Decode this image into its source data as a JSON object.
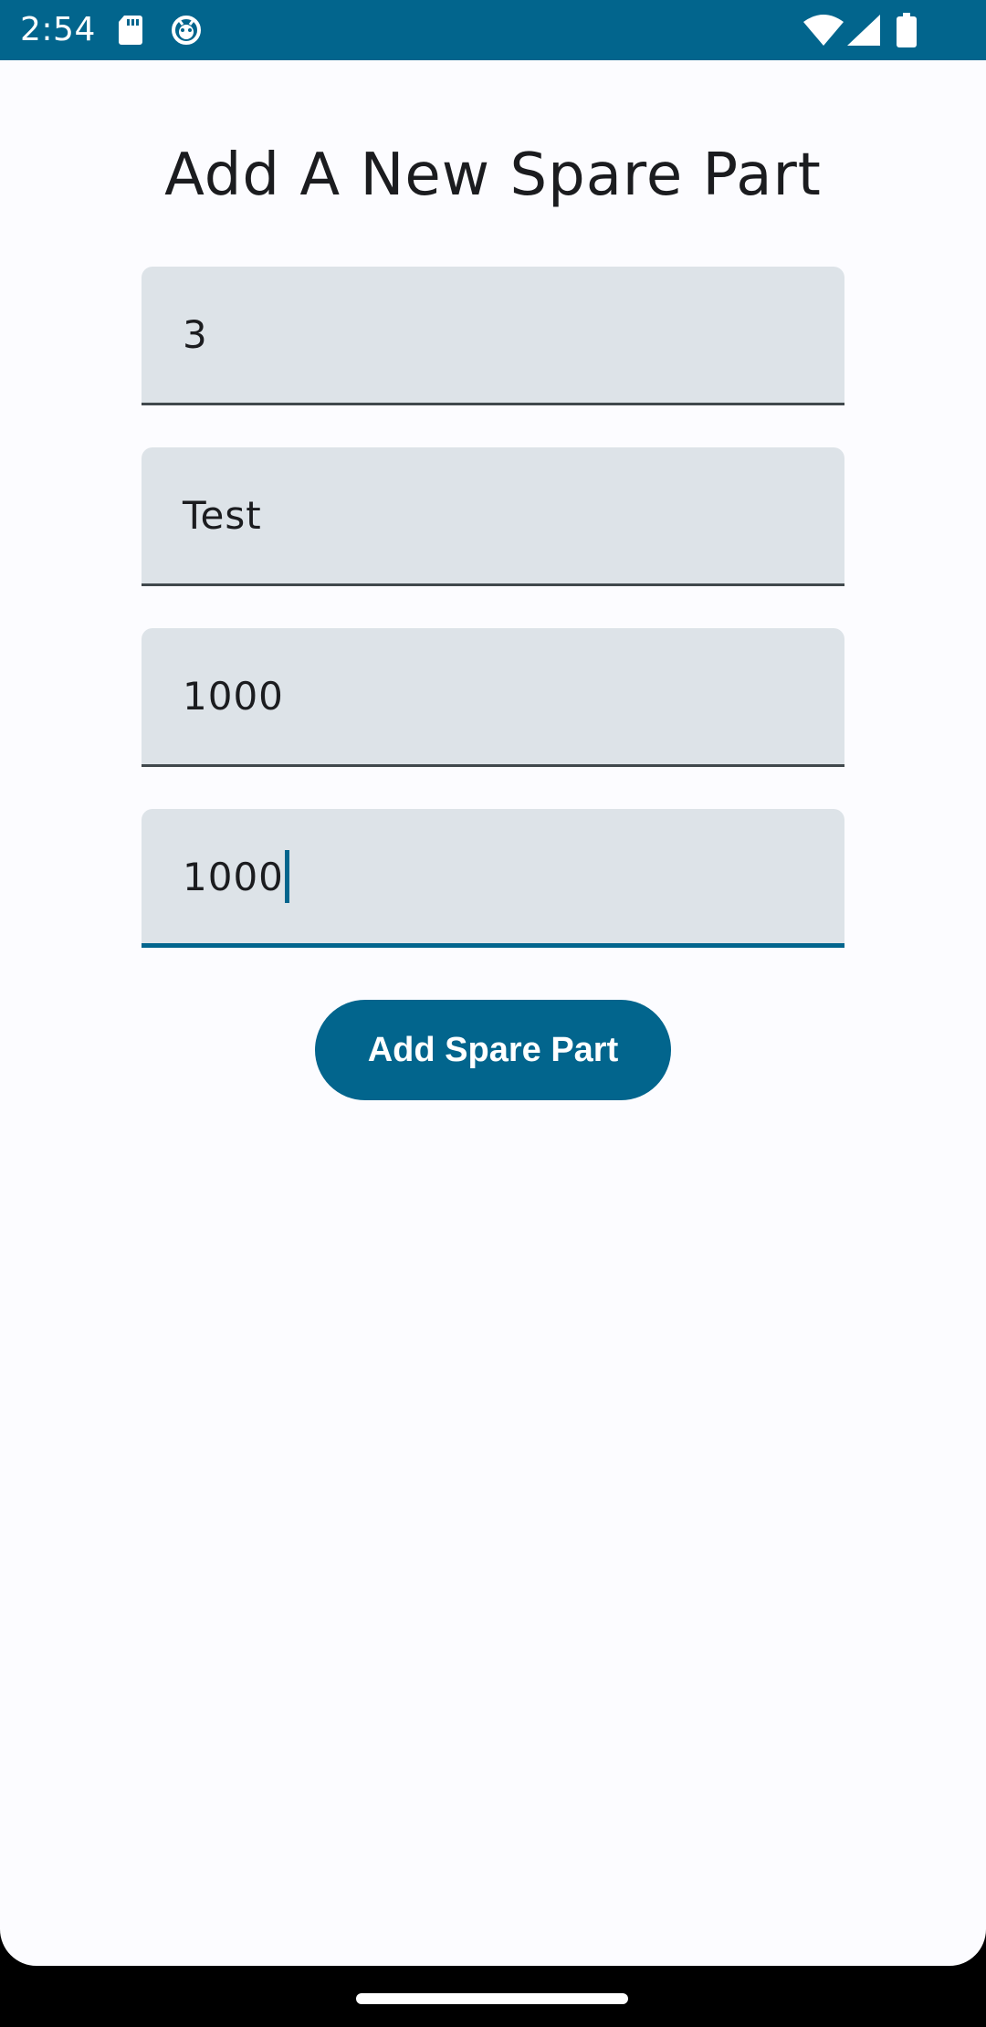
{
  "status_bar": {
    "time": "2:54",
    "icons_left": [
      "sd-card-icon",
      "android-debug-icon"
    ],
    "icons_right": [
      "wifi-icon",
      "cell-signal-icon",
      "battery-icon"
    ],
    "color": "#02658d"
  },
  "page": {
    "title": "Add A New Spare Part"
  },
  "form": {
    "fields": [
      {
        "value": "3"
      },
      {
        "value": "Test"
      },
      {
        "value": "1000"
      },
      {
        "value": "1000",
        "focused": true
      }
    ],
    "submit_label": "Add Spare Part"
  },
  "colors": {
    "primary": "#02658d",
    "background": "#fcfcff",
    "field_background": "#dde3e8"
  }
}
